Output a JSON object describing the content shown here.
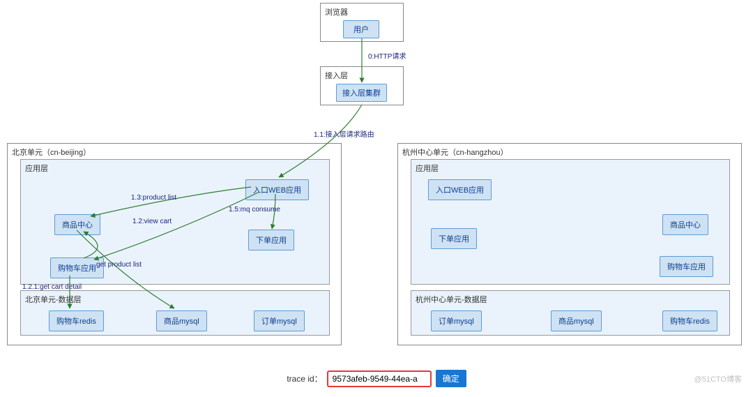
{
  "top": {
    "browser_group": "浏览器",
    "user": "用户",
    "access_group": "接入层",
    "access_cluster": "接入层集群"
  },
  "beijing": {
    "title": "北京单元（cn-beijing）",
    "app_layer": "应用层",
    "web_app": "入口WEB应用",
    "product_center": "商品中心",
    "order_app": "下单应用",
    "cart_app": "购物车应用",
    "data_layer": "北京单元-数据层",
    "cart_redis": "购物车redis",
    "product_mysql": "商品mysql",
    "order_mysql": "订单mysql"
  },
  "hangzhou": {
    "title": "杭州中心单元（cn-hangzhou）",
    "app_layer": "应用层",
    "web_app": "入口WEB应用",
    "order_app": "下单应用",
    "product_center": "商品中心",
    "cart_app": "购物车应用",
    "data_layer": "杭州中心单元-数据层",
    "order_mysql": "订单mysql",
    "product_mysql": "商品mysql",
    "cart_redis": "购物车redis"
  },
  "edges": {
    "http_req": "0:HTTP请求",
    "route": "1.1:接入层请求路由",
    "product_list": "1.3:product list",
    "view_cart": "1.2:view cart",
    "mq_consume": "1.5:mq consume",
    "get_product_list": "get product list",
    "get_cart_detail": "1.2.1:get cart detail"
  },
  "footer": {
    "trace_label": "trace id：",
    "trace_value": "9573afeb-9549-44ea-a",
    "confirm": "确定"
  },
  "watermark": "@51CTO博客"
}
